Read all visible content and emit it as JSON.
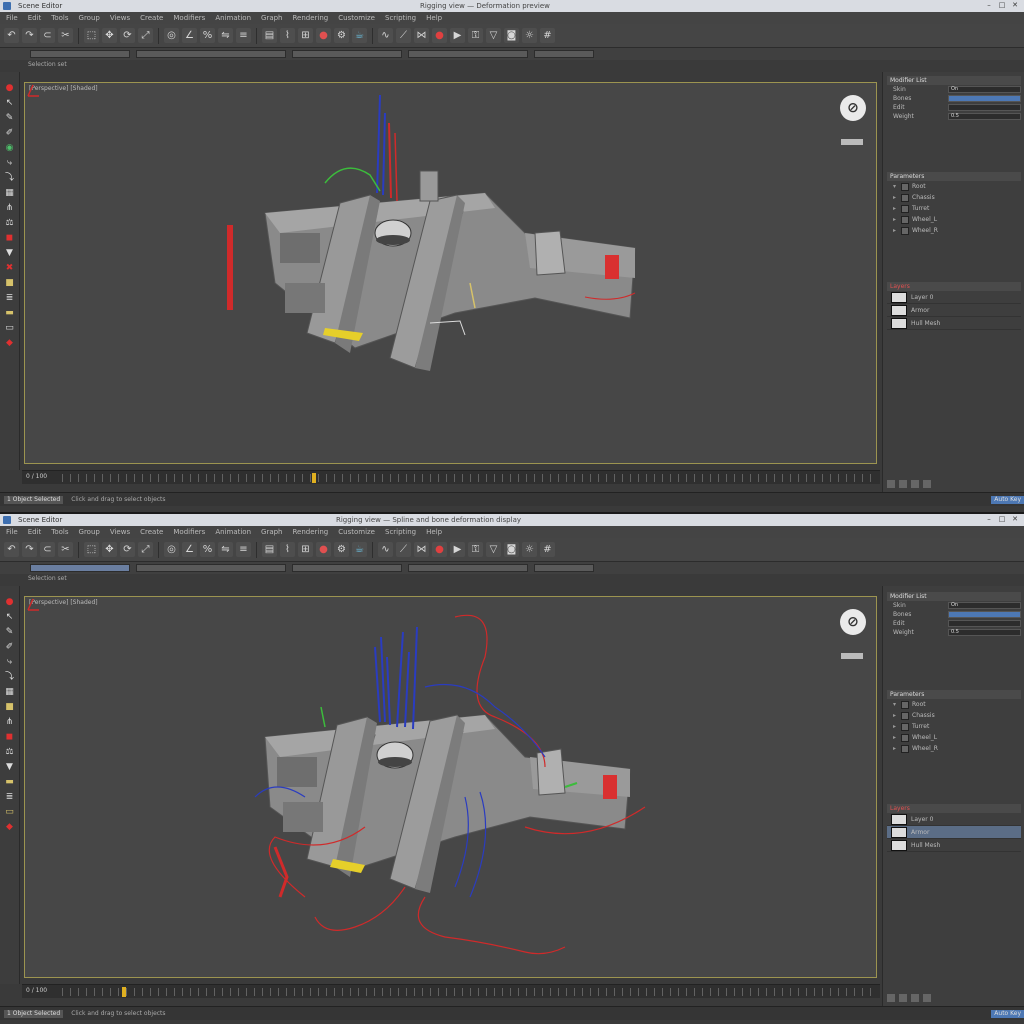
{
  "top": {
    "title": "Scene Editor",
    "center_title": "Rigging view — Deformation preview",
    "menu": [
      "File",
      "Edit",
      "Tools",
      "Group",
      "Views",
      "Create",
      "Modifiers",
      "Animation",
      "Graph",
      "Rendering",
      "Customize",
      "Scripting",
      "Help"
    ],
    "selection_label": "Selection set",
    "viewport_label": "[Perspective] [Shaded]",
    "timeline_label": "0 / 100",
    "status_left": "1 Object Selected",
    "status_mid": "Click and drag to select objects",
    "status_right": "Auto Key",
    "panel": {
      "head1": "Modifier List",
      "rows": [
        {
          "k": "Skin",
          "v": "On"
        },
        {
          "k": "Bones",
          "v": "",
          "hl": true
        },
        {
          "k": "Edit",
          "v": ""
        },
        {
          "k": "Weight",
          "v": "0.5"
        }
      ],
      "head2": "Parameters",
      "tree": [
        "Root",
        "Chassis",
        "Turret",
        "Wheel_L",
        "Wheel_R"
      ],
      "head3": "Layers",
      "layers": [
        "Layer 0",
        "Armor",
        "Hull Mesh"
      ]
    }
  },
  "bottom": {
    "title": "Scene Editor",
    "center_title": "Rigging view — Spline and bone deformation display",
    "menu": [
      "File",
      "Edit",
      "Tools",
      "Group",
      "Views",
      "Create",
      "Modifiers",
      "Animation",
      "Graph",
      "Rendering",
      "Customize",
      "Scripting",
      "Help"
    ],
    "selection_label": "Selection set",
    "viewport_label": "[Perspective] [Shaded]",
    "timeline_label": "0 / 100",
    "status_left": "1 Object Selected",
    "status_mid": "Click and drag to select objects",
    "status_right": "Auto Key",
    "panel": {
      "head1": "Modifier List",
      "rows": [
        {
          "k": "Skin",
          "v": "On"
        },
        {
          "k": "Bones",
          "v": "",
          "hl": true
        },
        {
          "k": "Edit",
          "v": ""
        },
        {
          "k": "Weight",
          "v": "0.5"
        }
      ],
      "head2": "Parameters",
      "tree": [
        "Root",
        "Chassis",
        "Turret",
        "Wheel_L",
        "Wheel_R"
      ],
      "head3": "Layers",
      "layers": [
        "Layer 0",
        "Armor",
        "Hull Mesh"
      ]
    }
  },
  "colors": {
    "viewport_border": "#9c9450",
    "selection_blue": "#4d78b4",
    "spline_red": "#d02a2a",
    "spline_blue": "#2a3cc0",
    "gizmo_yellow": "#e6cf2a",
    "hull_gray": "#8d8d8d"
  },
  "icons": [
    "undo-icon",
    "redo-icon",
    "link-icon",
    "unlink-icon",
    "select-icon",
    "move-icon",
    "rotate-icon",
    "scale-icon",
    "snap-icon",
    "render-icon",
    "material-icon"
  ]
}
